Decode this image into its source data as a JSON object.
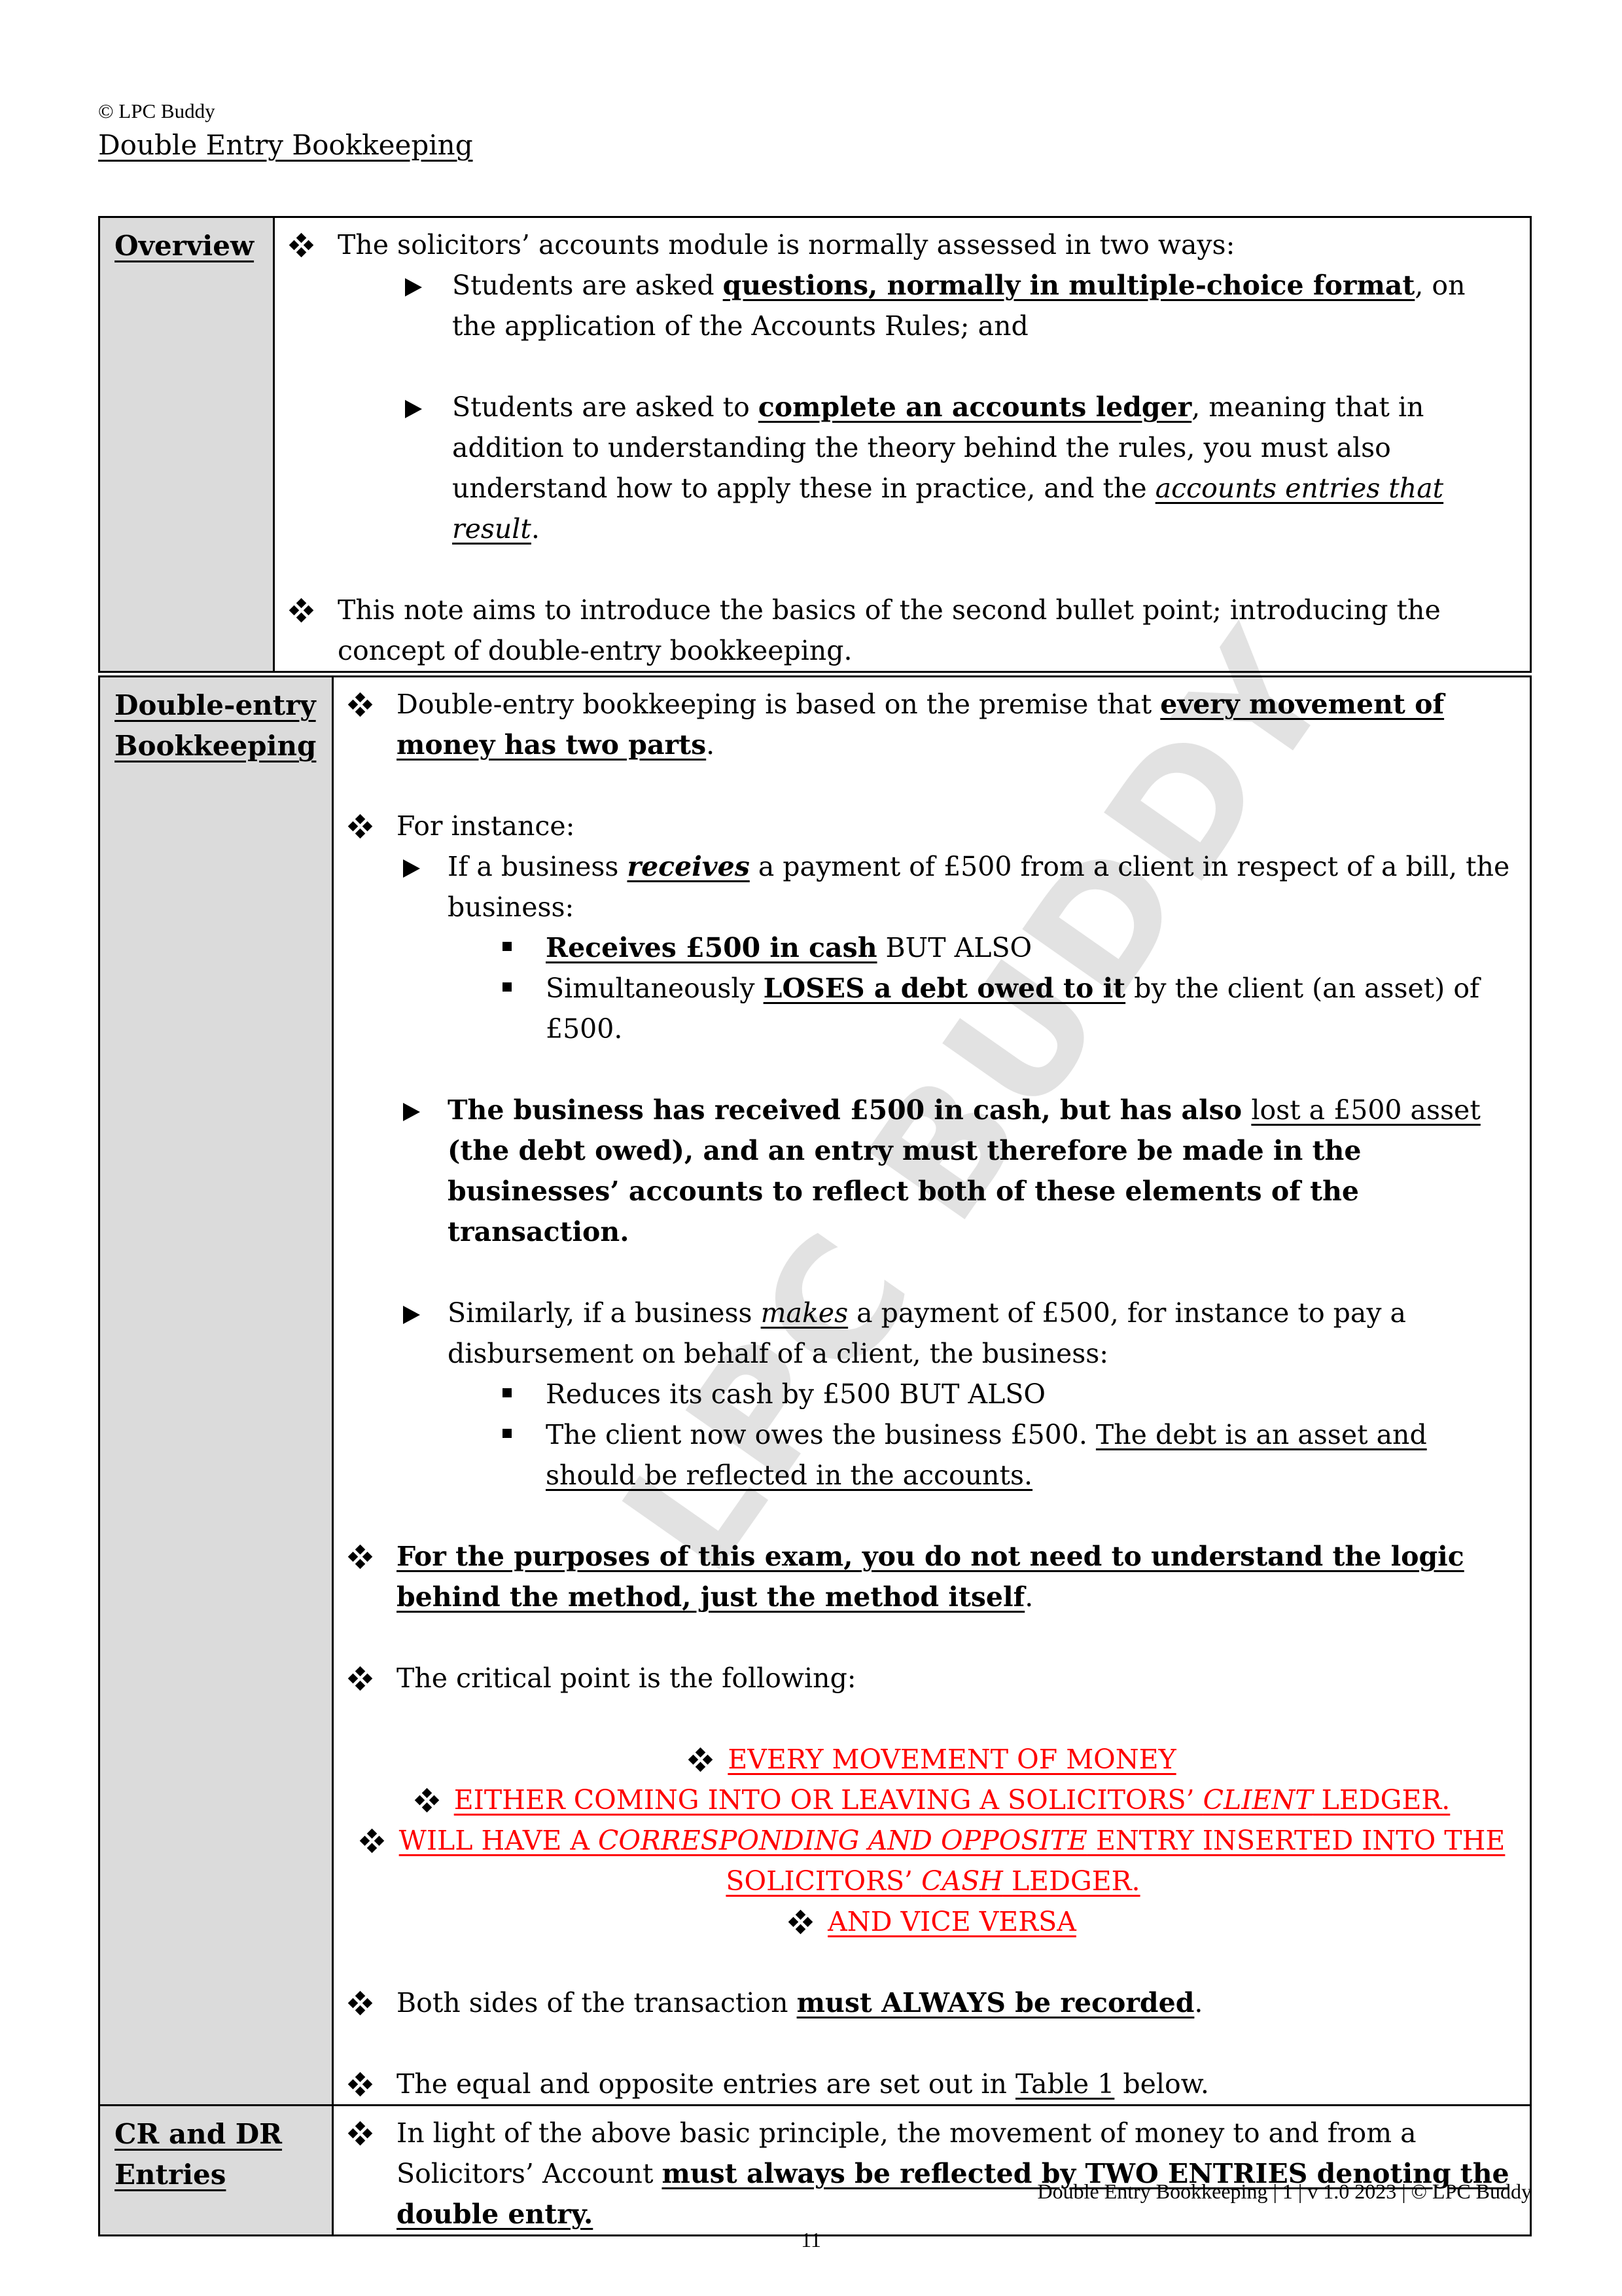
{
  "header": {
    "copyright": "© LPC Buddy",
    "title": "Double Entry Bookkeeping"
  },
  "watermark": "LPC BUDDY",
  "overview": {
    "label": "Overview",
    "intro": "The solicitors’ accounts module is normally assessed in two ways:",
    "way1": {
      "pre": "Students are asked ",
      "emph": "questions, normally in multiple-choice format",
      "post": ", on the application of the Accounts Rules; and"
    },
    "way2": {
      "pre": "Students are asked to ",
      "emph": "complete an accounts ledger",
      "mid": ", meaning that in addition to understanding the theory behind the rules, you must also understand how to apply these in practice, and the ",
      "italic": "accounts entries that result",
      "post": "."
    },
    "aim": "This note aims to introduce the basics of the second bullet point; introducing the concept of double-entry bookkeeping."
  },
  "double_entry": {
    "label_line1": "Double-entry",
    "label_line2": "Bookkeeping",
    "premise": {
      "pre": "Double-entry bookkeeping is based on the premise that ",
      "emph": "every movement of money has two parts",
      "post": "."
    },
    "for_instance": "For instance:",
    "receives_example": {
      "pre": "If a business ",
      "emph": "receives",
      "post": " a payment of £500 from a client in respect of a bill, the business:",
      "sub1_emph": "Receives £500 in cash",
      "sub1_post": " BUT ALSO",
      "sub2_pre": "Simultaneously ",
      "sub2_emph": "LOSES a debt owed to it",
      "sub2_post": " by the client (an asset) of £500."
    },
    "summary": {
      "pre": "The business has received £500 in cash, but has also ",
      "emph": "lost a £500 asset",
      "post": " (the debt owed), and an entry must therefore be made in the businesses’ accounts to reflect both of these elements of the transaction."
    },
    "makes_example": {
      "pre": "Similarly, if a business ",
      "emph": "makes",
      "post": " a payment of £500, for instance to pay a disbursement on behalf of a client, the business:",
      "sub1": "Reduces its cash by £500 BUT ALSO",
      "sub2_pre": "The client now owes the business £500. ",
      "sub2_emph": "The debt is an asset and should be reflected in the accounts."
    },
    "exam_note": {
      "emph": "For the purposes of this exam, you do not need to understand the logic behind the method, just the method itself",
      "post": "."
    },
    "critical_point": "The critical point is the following:",
    "red_points": {
      "line1": "EVERY MOVEMENT OF MONEY",
      "line2_pre": "EITHER COMING INTO OR LEAVING A SOLICITORS’ ",
      "line2_italic": "CLIENT",
      "line2_post": " LEDGER.",
      "line3_pre": "WILL HAVE A ",
      "line3_italic": "CORRESPONDING AND OPPOSITE",
      "line3_post": " ENTRY INSERTED INTO THE",
      "line4_pre": "SOLICITORS’ ",
      "line4_italic": "CASH",
      "line4_post": " LEDGER.",
      "line5": "AND VICE VERSA"
    },
    "both_sides": {
      "pre": "Both sides of the transaction ",
      "emph": "must ALWAYS be recorded",
      "post": "."
    },
    "table_ref": {
      "pre": "The equal and opposite entries are set out in ",
      "link": "Table 1",
      "post": " below."
    }
  },
  "cr_dr": {
    "label_line1": "CR and DR",
    "label_line2": "Entries",
    "text_pre": "In light of the above basic principle, the movement of money to and from a Solicitors’ Account ",
    "text_emph": "must always be reflected by TWO ENTRIES denoting the double entry."
  },
  "footer": {
    "text": "Double Entry Bookkeeping | 1 | v 1.0 2023 | © LPC Buddy",
    "page_number": "11"
  },
  "colors": {
    "label_bg": "#d9d9d9",
    "emphasis_red": "#ff0000",
    "watermark": "#e2e2e2"
  }
}
